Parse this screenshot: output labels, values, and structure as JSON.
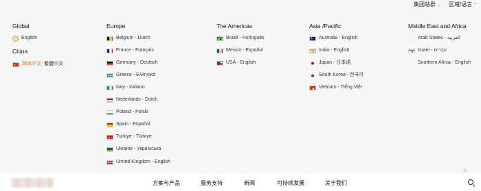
{
  "topbar": {
    "group_site": "集团站群",
    "region_language": "区域/语言"
  },
  "regions": {
    "global": {
      "title": "Global",
      "english": "English"
    },
    "china": {
      "title": "China",
      "simplified": "简体中文",
      "traditional": "繁體中文"
    },
    "europe": {
      "title": "Europe",
      "items": [
        {
          "label": "Belgium - Dutch",
          "flag": "belgium-flag"
        },
        {
          "label": "France - Français",
          "flag": "france-flag"
        },
        {
          "label": "Germany - Deutsch",
          "flag": "germany-flag"
        },
        {
          "label": "Greece - Ελληνικά",
          "flag": "greece-flag"
        },
        {
          "label": "Italy - Italiano",
          "flag": "italy-flag"
        },
        {
          "label": "Nederlands - Dutch",
          "flag": "netherlands-flag"
        },
        {
          "label": "Poland - Polski",
          "flag": "poland-flag"
        },
        {
          "label": "Spain - Español",
          "flag": "spain-flag"
        },
        {
          "label": "Turkiye - Türkiye",
          "flag": "turkey-flag"
        },
        {
          "label": "Ukraine - Українська",
          "flag": "ukraine-flag"
        },
        {
          "label": "United Kingdom - English",
          "flag": "uk-flag"
        }
      ]
    },
    "americas": {
      "title": "The Americas",
      "items": [
        {
          "label": "Brazil - Português",
          "flag": "brazil-flag"
        },
        {
          "label": "Mexico - Español",
          "flag": "mexico-flag"
        },
        {
          "label": "USA - English",
          "flag": "usa-flag"
        }
      ]
    },
    "asia": {
      "title": "Asia /Pacific",
      "items": [
        {
          "label": "Australia - English",
          "flag": "australia-flag"
        },
        {
          "label": "India - English",
          "flag": "india-flag"
        },
        {
          "label": "Japan - 日本语",
          "flag": "japan-flag"
        },
        {
          "label": "South Korea - 한국어",
          "flag": "south-korea-flag"
        },
        {
          "label": "Vietnam - Tiếng Việt",
          "flag": "vietnam-flag"
        }
      ]
    },
    "middle_east": {
      "title": "Middle East and Africa",
      "items": [
        {
          "label": "Arab States - العربية",
          "flag": ""
        },
        {
          "label": "Israel - עברית",
          "flag": "israel-flag"
        },
        {
          "label": "Southern Africa - English",
          "flag": ""
        }
      ]
    }
  },
  "nav": {
    "solutions": "方案与产品",
    "services": "服务支持",
    "news": "新闻",
    "sustainability": "可持续发展",
    "about": "关于我们"
  },
  "icons": {
    "close": "close-icon",
    "search": "search-icon",
    "globe": "globe-icon",
    "chevron": "chevron-down-icon"
  },
  "colors": {
    "accent": "#e06a1b",
    "panel_bg": "#f7f7f7"
  }
}
